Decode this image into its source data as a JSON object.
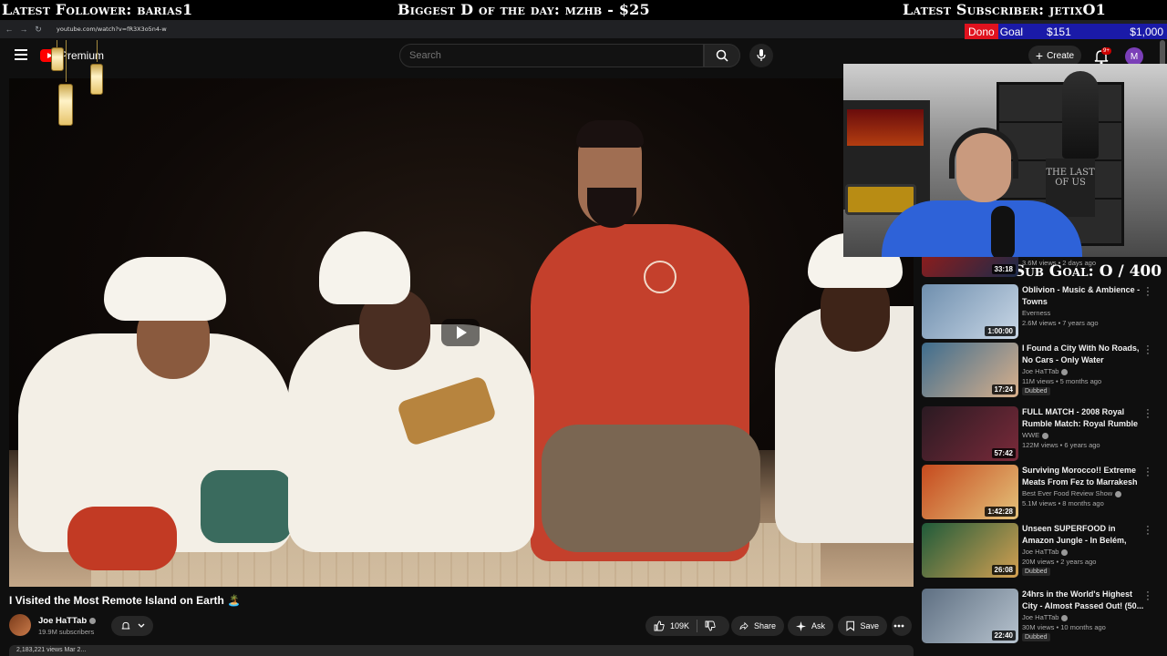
{
  "overlay": {
    "latest_follower": "Latest Follower: barias1",
    "biggest_donation": "Biggest D of the day: mzhb - $25",
    "latest_subscriber": "Latest Subscriber: jetixO1",
    "dono_goal_label_a": "Dono",
    "dono_goal_label_b": "Goal",
    "dono_goal_current": "$151",
    "dono_goal_target": "$1,000",
    "sub_goal": "Sub Goal: O / 400"
  },
  "browser": {
    "url": "youtube.com/watch?v=fR3X3o5n4-w"
  },
  "header": {
    "logo_text": "Premium",
    "search_placeholder": "Search",
    "create_label": "Create",
    "notif_count": "9+",
    "avatar_letter": "M"
  },
  "video": {
    "title": "I Visited the Most Remote Island on Earth 🏝️",
    "channel": "Joe HaTTab",
    "subscribers": "19.9M subscribers",
    "likes": "109K",
    "share_label": "Share",
    "ask_label": "Ask",
    "save_label": "Save",
    "description_peek": "2,183,221 views  Mar 2..."
  },
  "webcam": {
    "poster_text": "THE LAST OF US"
  },
  "recommendations": [
    {
      "title": "",
      "channel": "",
      "meta": "3.6M views • 2 days ago",
      "duration": "33:18",
      "dubbed": false,
      "verified": false,
      "thumb": [
        "#8a1d1d",
        "#1a2a4a"
      ]
    },
    {
      "title": "Oblivion - Music & Ambience - Towns",
      "channel": "Everness",
      "meta": "2.6M views • 7 years ago",
      "duration": "1:00:00",
      "dubbed": false,
      "verified": false,
      "thumb": [
        "#6f8fae",
        "#c9d7e6"
      ]
    },
    {
      "title": "I Found a City With No Roads, No Cars - Only Water",
      "channel": "Joe HaTTab",
      "meta": "11M views • 5 months ago",
      "duration": "17:24",
      "dubbed": true,
      "verified": true,
      "thumb": [
        "#3e6d8e",
        "#d9b08c"
      ]
    },
    {
      "title": "FULL MATCH - 2008 Royal Rumble Match: Royal Rumble ...",
      "channel": "WWE",
      "meta": "122M views • 6 years ago",
      "duration": "57:42",
      "dubbed": false,
      "verified": true,
      "thumb": [
        "#2a1a22",
        "#7a2a3a"
      ]
    },
    {
      "title": "Surviving Morocco!! Extreme Meats From Fez to Marrakesh",
      "channel": "Best Ever Food Review Show",
      "meta": "5.1M views • 8 months ago",
      "duration": "1:42:28",
      "dubbed": false,
      "verified": true,
      "thumb": [
        "#c64a1e",
        "#e4c27a"
      ]
    },
    {
      "title": "Unseen SUPERFOOD in Amazon Jungle - In Belém, Brazil",
      "channel": "Joe HaTTab",
      "meta": "20M views • 2 years ago",
      "duration": "26:08",
      "dubbed": true,
      "verified": true,
      "thumb": [
        "#1f5b3a",
        "#d4a052"
      ]
    },
    {
      "title": "24hrs in the World's Highest City - Almost Passed Out! (50...",
      "channel": "Joe HaTTab",
      "meta": "30M views • 10 months ago",
      "duration": "22:40",
      "dubbed": true,
      "verified": true,
      "thumb": [
        "#5e6f82",
        "#b7c3ce"
      ]
    }
  ],
  "labels": {
    "dubbed": "Dubbed"
  },
  "colors": {
    "background": "#0f0f0f",
    "accent_red": "#ff0000",
    "dono_blue": "#1a1aa8",
    "sweater": "#c4402c",
    "robe": "#f3efe6"
  }
}
